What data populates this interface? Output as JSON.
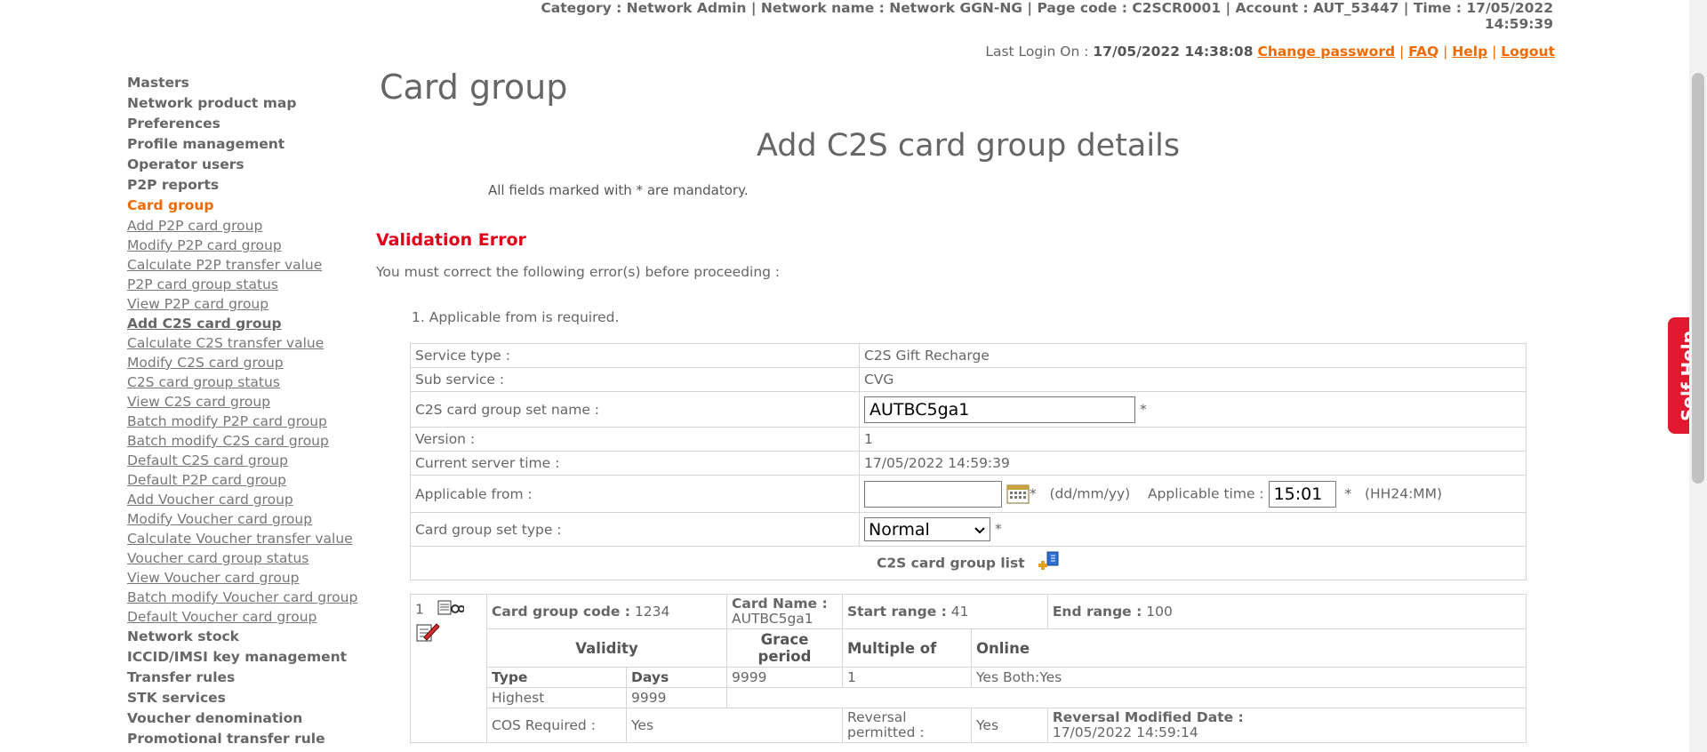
{
  "header": {
    "info_line1": "Category : Network Admin | Network name : Network GGN-NG | Page code : C2SCR0001 | Account : AUT_53447 | Time : 17/05/2022",
    "info_line2": "14:59:39",
    "last_login_label": "Last Login On :",
    "last_login_value": "17/05/2022 14:38:08",
    "change_password": "Change password",
    "faq": "FAQ",
    "help": "Help",
    "logout": "Logout"
  },
  "sidebar": {
    "top_items": [
      "Masters",
      "Network product map",
      "Preferences",
      "Profile management",
      "Operator users",
      "P2P reports"
    ],
    "active_section": "Card group",
    "sub_items": [
      "Add P2P card group",
      "Modify P2P card group",
      "Calculate P2P transfer value",
      "P2P card group status",
      "View P2P card group",
      "Add C2S card group",
      "Calculate C2S transfer value",
      "Modify C2S card group",
      "C2S card group status",
      "View C2S card group",
      "Batch modify P2P card group",
      "Batch modify C2S card group",
      "Default C2S card group",
      "Default P2P card group",
      "Add Voucher card group",
      "Modify Voucher card group",
      "Calculate Voucher transfer value",
      "Voucher card group status",
      "View Voucher card group",
      "Batch modify Voucher card group",
      "Default Voucher card group"
    ],
    "selected_sub_item": "Add C2S card group",
    "bottom_items": [
      "Network stock",
      "ICCID/IMSI key management",
      "Transfer rules",
      "STK services",
      "Voucher denomination",
      "Promotional transfer rule"
    ]
  },
  "main": {
    "page_title": "Card group",
    "sub_title": "Add C2S card group details",
    "mandatory_note": "All fields marked with * are mandatory.",
    "validation_title": "Validation Error",
    "error_intro": "You must correct the following error(s) before proceeding :",
    "errors": [
      "1. Applicable from is required."
    ]
  },
  "form": {
    "service_type_label": "Service type :",
    "service_type_value": "C2S Gift Recharge",
    "sub_service_label": "Sub service :",
    "sub_service_value": "CVG",
    "set_name_label": "C2S card group set name :",
    "set_name_value": "AUTBC5ga1",
    "version_label": "Version :",
    "version_value": "1",
    "server_time_label": "Current server time :",
    "server_time_value": "17/05/2022 14:59:39",
    "applicable_from_label": "Applicable from :",
    "applicable_from_value": "",
    "date_format": "(dd/mm/yy)",
    "applicable_time_label": "Applicable time :",
    "applicable_time_value": "15:01",
    "time_format": "(HH24:MM)",
    "set_type_label": "Card group set type :",
    "set_type_value": "Normal",
    "required_mark": "*",
    "list_title": "C2S card group list"
  },
  "card_list": {
    "row_number": "1",
    "code_label": "Card group code :",
    "code_value": "1234",
    "name_label": "Card Name :",
    "name_value": "AUTBC5ga1",
    "start_label": "Start range :",
    "start_value": "41",
    "end_label": "End range :",
    "end_value": "100",
    "validity_header": "Validity",
    "grace_header": "Grace period",
    "multiple_header": "Multiple of",
    "online_header": "Online",
    "type_header": "Type",
    "days_header": "Days",
    "grace_value": "9999",
    "multiple_value": "1",
    "online_value": "Yes Both:Yes",
    "type_value": "Highest",
    "days_value": "9999",
    "cos_label": "COS Required :",
    "cos_value": "Yes",
    "reversal_label": "Reversal permitted :",
    "reversal_value": "Yes",
    "reversal_date_label": "Reversal Modified Date :",
    "reversal_date_value": "17/05/2022 14:59:14"
  },
  "self_help": "Self Help",
  "colors": {
    "accent": "#f06a00",
    "error": "#e0001a",
    "self_help_bg": "#e2182f"
  },
  "icons": [
    "calendar-icon",
    "view-icon",
    "edit-icon",
    "add-icon",
    "chevron-down-icon"
  ]
}
